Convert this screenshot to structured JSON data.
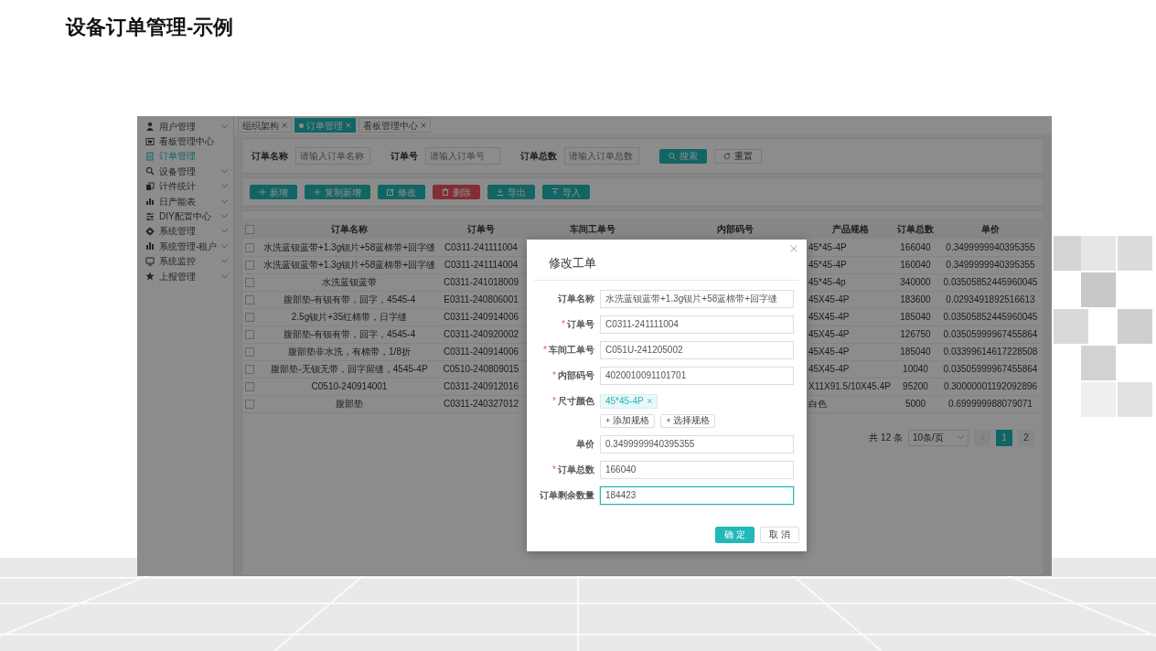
{
  "slide": {
    "title": "设备订单管理-示例"
  },
  "sidebar": {
    "items": [
      {
        "label": "用户管理",
        "has_submenu": true,
        "selected": false
      },
      {
        "label": "看板管理中心",
        "has_submenu": false,
        "selected": false
      },
      {
        "label": "订单管理",
        "has_submenu": false,
        "selected": true
      },
      {
        "label": "设备管理",
        "has_submenu": true,
        "selected": false
      },
      {
        "label": "计件统计",
        "has_submenu": true,
        "selected": false
      },
      {
        "label": "日产能表",
        "has_submenu": true,
        "selected": false
      },
      {
        "label": "DIY配置中心",
        "has_submenu": true,
        "selected": false
      },
      {
        "label": "系统管理",
        "has_submenu": true,
        "selected": false
      },
      {
        "label": "系统管理-租户",
        "has_submenu": true,
        "selected": false
      },
      {
        "label": "系统监控",
        "has_submenu": true,
        "selected": false
      },
      {
        "label": "上报管理",
        "has_submenu": true,
        "selected": false
      }
    ]
  },
  "tabs": [
    {
      "label": "组织架构",
      "selected": false
    },
    {
      "label": "订单管理",
      "selected": true
    },
    {
      "label": "看板管理中心",
      "selected": false
    }
  ],
  "search": {
    "fields": [
      {
        "label": "订单名称",
        "placeholder": "请输入订单名称"
      },
      {
        "label": "订单号",
        "placeholder": "请输入订单号"
      },
      {
        "label": "订单总数",
        "placeholder": "请输入订单总数"
      }
    ],
    "buttons": [
      {
        "label": "搜索",
        "kind": "primary"
      },
      {
        "label": "重置",
        "kind": "default"
      }
    ]
  },
  "toolbar": [
    {
      "label": "新增",
      "kind": "primary"
    },
    {
      "label": "复制新增",
      "kind": "primary"
    },
    {
      "label": "修改",
      "kind": "primary"
    },
    {
      "label": "删除",
      "kind": "danger"
    },
    {
      "label": "导出",
      "kind": "primary"
    },
    {
      "label": "导入",
      "kind": "primary"
    }
  ],
  "table": {
    "select_all_checked": false,
    "columns": [
      "订单名称",
      "订单号",
      "车间工单号",
      "内部码号",
      "产品规格",
      "订单总数",
      "单价"
    ],
    "rows": [
      {
        "checked": false,
        "name": "水洗蓝钡蓝带+1.3g钡片+58蓝棉带+回字缝",
        "order_no": "C0311-241111004",
        "spec": "45*45-4P",
        "total": "166040",
        "price": "0.3499999940395355"
      },
      {
        "checked": false,
        "name": "水洗蓝钡蓝带+1.3g钡片+58蓝棉带+回字缝",
        "order_no": "C0311-241114004",
        "spec": "45*45-4P",
        "total": "160040",
        "price": "0.3499999940395355"
      },
      {
        "checked": false,
        "name": "水洗蓝钡蓝带",
        "order_no": "C0311-241018009",
        "spec": "45*45-4p",
        "total": "340000",
        "price": "0.03505852445960045"
      },
      {
        "checked": false,
        "name": "腹部垫-有钡有带，回字，4545-4",
        "order_no": "E0311-240806001",
        "spec": "45X45-4P",
        "total": "183600",
        "price": "0.0293491892516613"
      },
      {
        "checked": false,
        "name": "2.5g钡片+35红棉带，日字缝",
        "order_no": "C0311-240914006",
        "spec": "45X45-4P",
        "total": "185040",
        "price": "0.03505852445960045"
      },
      {
        "checked": false,
        "name": "腹部垫-有钡有带，回字，4545-4",
        "order_no": "C0311-240920002",
        "spec": "45X45-4P",
        "total": "126750",
        "price": "0.03505999967455864"
      },
      {
        "checked": false,
        "name": "腹部垫非水洗，有棉带，1/8折",
        "order_no": "C0311-240914006",
        "spec": "45X45-4P",
        "total": "185040",
        "price": "0.03399614617228508"
      },
      {
        "checked": false,
        "name": "腹部垫-无钡无带，回字留缝，4545-4P",
        "order_no": "C0510-240809015",
        "spec": "45X45-4P",
        "total": "10040",
        "price": "0.03505999967455864"
      },
      {
        "checked": false,
        "name": "C0510-240914001",
        "order_no": "C0311-240912016",
        "spec": "X11X91.5/10X45.4P",
        "total": "95200",
        "price": "0.30000001192092896"
      },
      {
        "checked": false,
        "name": "腹部垫",
        "order_no": "C0311-240327012",
        "spec": "白色",
        "total": "5000",
        "price": "0.699999988079071"
      }
    ]
  },
  "pagination": {
    "total": "共 12 条",
    "page_size": "10条/页",
    "pages": [
      {
        "label": "1",
        "selected": true
      },
      {
        "label": "2",
        "selected": false
      }
    ]
  },
  "modal": {
    "title": "修改工单",
    "required_mark": "*",
    "fields": [
      {
        "label": "订单名称",
        "kind": "text",
        "required": false,
        "focused": false,
        "value": "水洗蓝钡蓝带+1.3g钡片+58蓝棉带+回字缝"
      },
      {
        "label": "订单号",
        "kind": "text",
        "required": true,
        "focused": false,
        "value": "C0311-241111004"
      },
      {
        "label": "车间工单号",
        "kind": "text",
        "required": true,
        "focused": false,
        "value": "C051U-241205002"
      },
      {
        "label": "内部码号",
        "kind": "text",
        "required": true,
        "focused": false,
        "value": "4020010091101701"
      },
      {
        "label": "尺寸颜色",
        "kind": "tags",
        "required": true,
        "tags": [
          "45*45-4P"
        ],
        "actions": [
          "+ 添加规格",
          "+ 选择规格"
        ]
      },
      {
        "label": "单价",
        "kind": "text",
        "required": false,
        "focused": false,
        "value": "0.3499999940395355"
      },
      {
        "label": "订单总数",
        "kind": "text",
        "required": true,
        "focused": false,
        "value": "166040"
      },
      {
        "label": "订单剩余数量",
        "kind": "text",
        "required": false,
        "focused": true,
        "value": "184423"
      }
    ],
    "buttons": [
      {
        "label": "确 定",
        "kind": "primary"
      },
      {
        "label": "取 消",
        "kind": "default"
      }
    ]
  }
}
